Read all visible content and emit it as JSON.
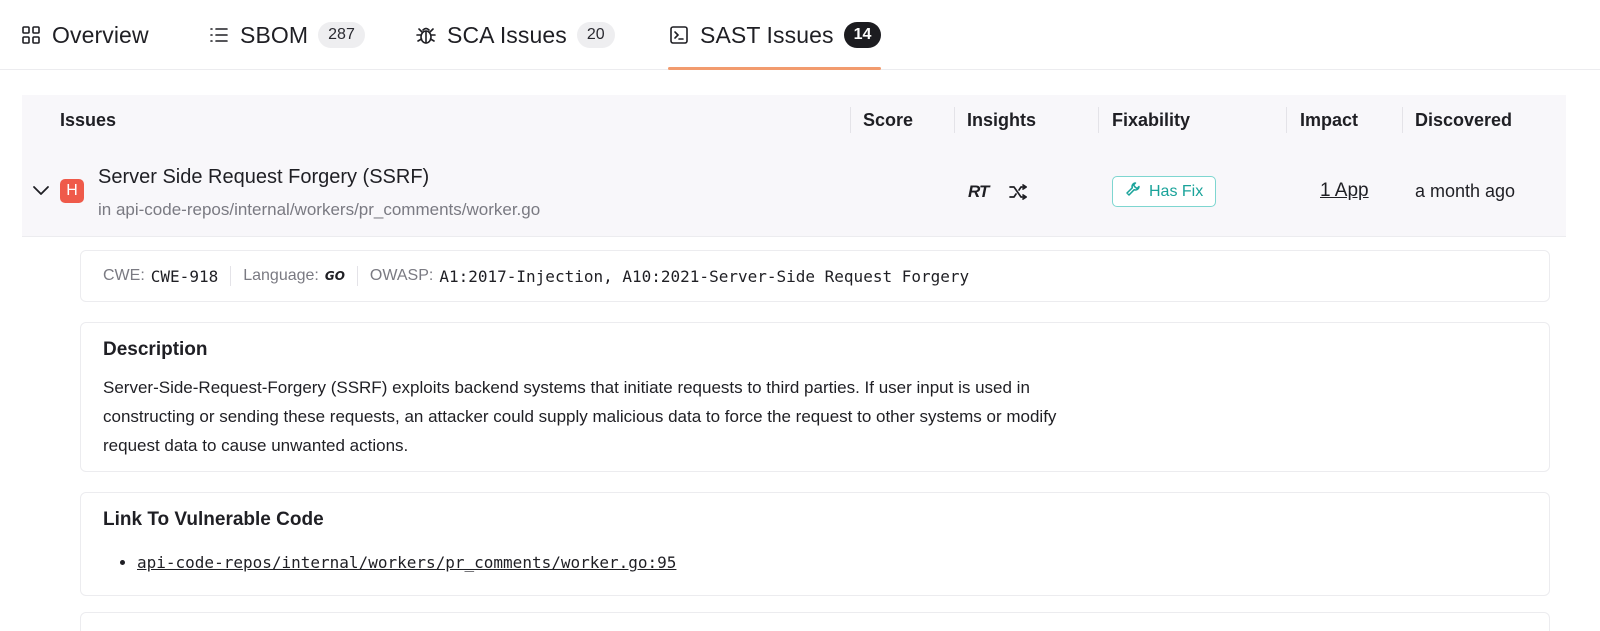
{
  "tabs": [
    {
      "label": "Overview",
      "icon": "grid-icon",
      "count": null
    },
    {
      "label": "SBOM",
      "icon": "list-icon",
      "count": "287"
    },
    {
      "label": "SCA Issues",
      "icon": "bug-icon",
      "count": "20"
    },
    {
      "label": "SAST Issues",
      "icon": "terminal-icon",
      "count": "14",
      "active": true
    }
  ],
  "table": {
    "headers": [
      "Issues",
      "Score",
      "Insights",
      "Fixability",
      "Impact",
      "Discovered"
    ]
  },
  "issue": {
    "severity": "H",
    "title": "Server Side Request Forgery (SSRF)",
    "path": "in api-code-repos/internal/workers/pr_comments/worker.go",
    "insight_rt": "RT",
    "fixability": "Has Fix",
    "impact": "1 App",
    "discovered": "a month ago"
  },
  "meta": {
    "cwe_label": "CWE:",
    "cwe_value": "CWE-918",
    "language_label": "Language:",
    "language_value": "GO",
    "owasp_label": "OWASP:",
    "owasp_value": "A1:2017-Injection, A10:2021-Server-Side Request Forgery"
  },
  "description": {
    "title": "Description",
    "text": "Server-Side-Request-Forgery (SSRF) exploits backend systems that initiate requests to third parties. If user input is used in constructing or sending these requests, an attacker could supply malicious data to force the request to other systems or modify request data to cause unwanted actions."
  },
  "vulnerable_code": {
    "title": "Link To Vulnerable Code",
    "links": [
      "api-code-repos/internal/workers/pr_comments/worker.go:95"
    ]
  },
  "colors": {
    "severity_high": "#ef5a4a",
    "active_tab_underline": "#f29b6e",
    "has_fix": "#1aa39a"
  }
}
